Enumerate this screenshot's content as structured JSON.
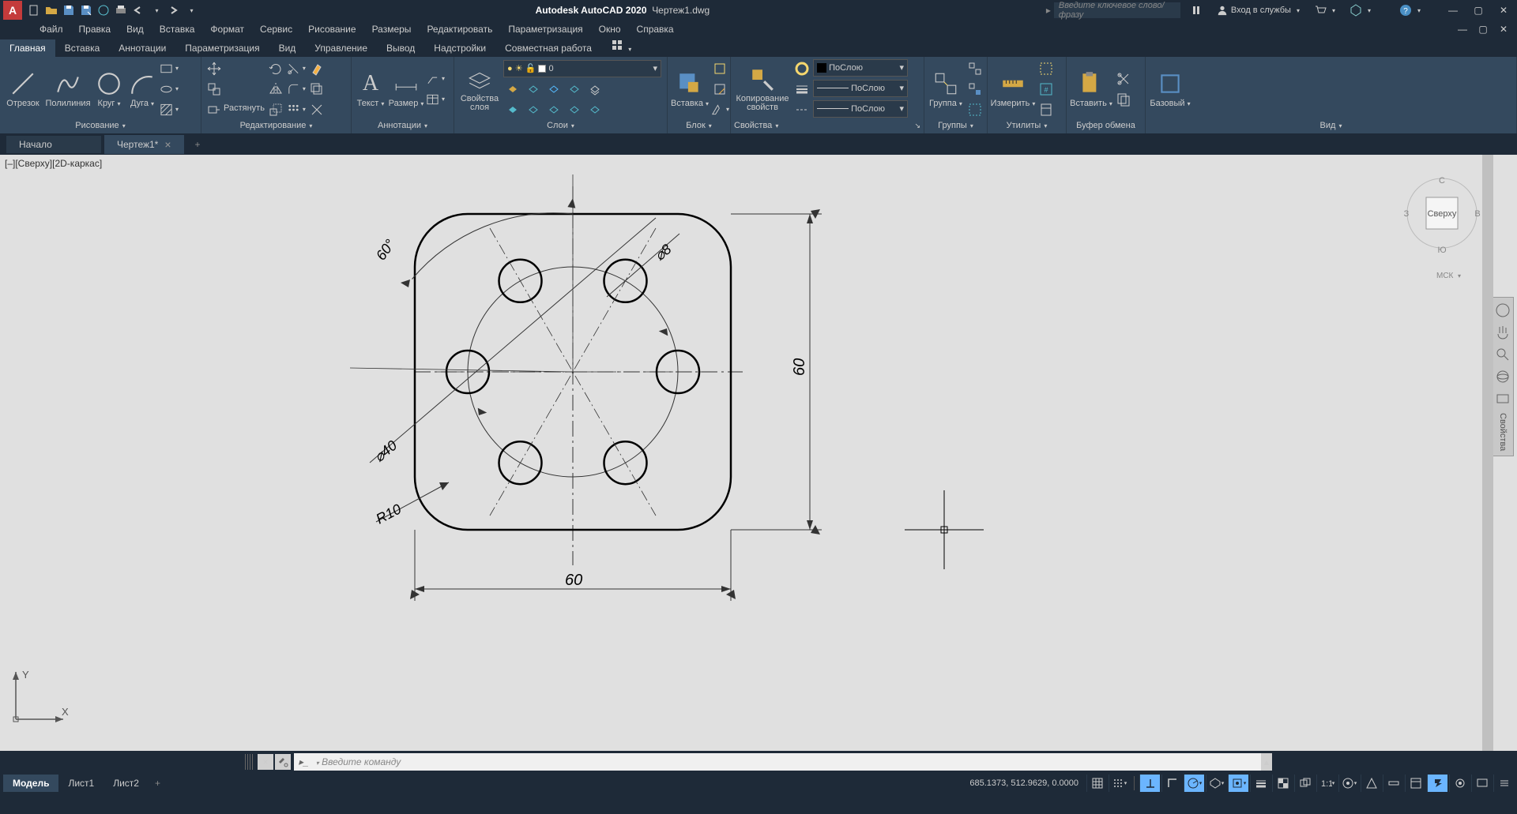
{
  "title_app": "Autodesk AutoCAD 2020",
  "title_file": "Чертеж1.dwg",
  "search_placeholder": "Введите ключевое слово/фразу",
  "signin": "Вход в службы",
  "menu": [
    "Файл",
    "Правка",
    "Вид",
    "Вставка",
    "Формат",
    "Сервис",
    "Рисование",
    "Размеры",
    "Редактировать",
    "Параметризация",
    "Окно",
    "Справка"
  ],
  "ribbon_tabs": [
    "Главная",
    "Вставка",
    "Аннотации",
    "Параметризация",
    "Вид",
    "Управление",
    "Вывод",
    "Надстройки",
    "Совместная работа"
  ],
  "panels": {
    "draw": "Рисование",
    "modify": "Редактирование",
    "annot": "Аннотации",
    "layers": "Слои",
    "block": "Блок",
    "props": "Свойства",
    "groups": "Группы",
    "utils": "Утилиты",
    "clipboard": "Буфер обмена",
    "view": "Вид"
  },
  "btns": {
    "line": "Отрезок",
    "pline": "Полилиния",
    "circle": "Круг",
    "arc": "Дуга",
    "text": "Текст",
    "dim": "Размер",
    "layerprops": "Свойства слоя",
    "stretch": "Растянуть",
    "insert": "Вставка",
    "matchprop": "Копирование свойств",
    "group": "Группа",
    "measure": "Измерить",
    "paste": "Вставить",
    "base": "Базовый"
  },
  "layer_current": "0",
  "bylayer": "ПоСлою",
  "doc_tabs": {
    "start": "Начало",
    "file": "Чертеж1*"
  },
  "view_label": "[–][Сверху][2D-каркас]",
  "viewcube": {
    "top": "Сверху",
    "n": "С",
    "s": "Ю",
    "e": "В",
    "w": "З",
    "wcs": "МСК"
  },
  "cmd_placeholder": "Введите команду",
  "status_tabs": [
    "Модель",
    "Лист1",
    "Лист2"
  ],
  "coords": "685.1373, 512.9629, 0.0000",
  "navbar_label": "Свойства",
  "drawing_dims": {
    "width": "60",
    "height": "60",
    "diam_bolt_circle": "⌀40",
    "diam_hole": "⌀8",
    "radius": "R10",
    "angle": "60°"
  }
}
